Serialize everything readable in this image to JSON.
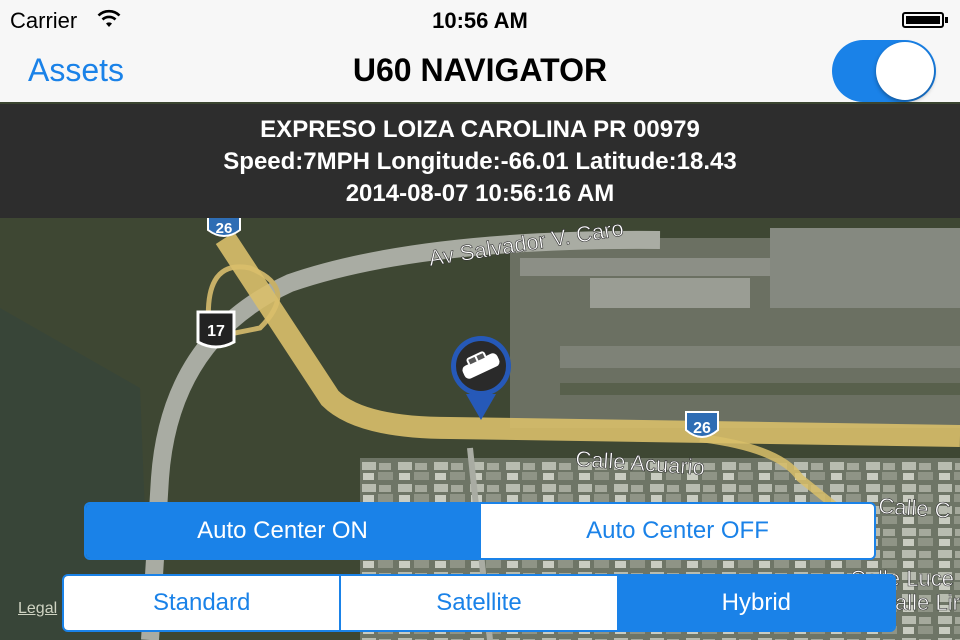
{
  "status": {
    "carrier": "Carrier",
    "time": "10:56 AM",
    "wifi_icon": "wifi-icon",
    "battery_icon": "battery-icon"
  },
  "nav": {
    "back_label": "Assets",
    "title": "U60 NAVIGATOR",
    "toggle_on": true
  },
  "info": {
    "address": "EXPRESO LOIZA CAROLINA PR 00979",
    "telemetry": "Speed:7MPH Longitude:-66.01 Latitude:18.43",
    "timestamp": "2014-08-07 10:56:16 AM"
  },
  "map": {
    "labels": {
      "av_salvador": "Av Salvador V. Caro",
      "calle_acuario": "Calle Acuario",
      "calle_c": "Calle C",
      "calle_luce": "Calle Luce",
      "calle_lira": "alle Lira",
      "shield_26_top": "26",
      "shield_26_mid": "26",
      "shield_17": "17"
    },
    "marker_icon": "car-pin-icon",
    "legal": "Legal"
  },
  "auto_center": {
    "options": [
      "Auto Center ON",
      "Auto Center OFF"
    ],
    "selected": "Auto Center ON"
  },
  "map_type": {
    "options": [
      "Standard",
      "Satellite",
      "Hybrid"
    ],
    "selected": "Hybrid"
  },
  "colors": {
    "accent": "#1a82e8",
    "infobar": "#2d2d2d",
    "road": "#d9bf6a"
  }
}
